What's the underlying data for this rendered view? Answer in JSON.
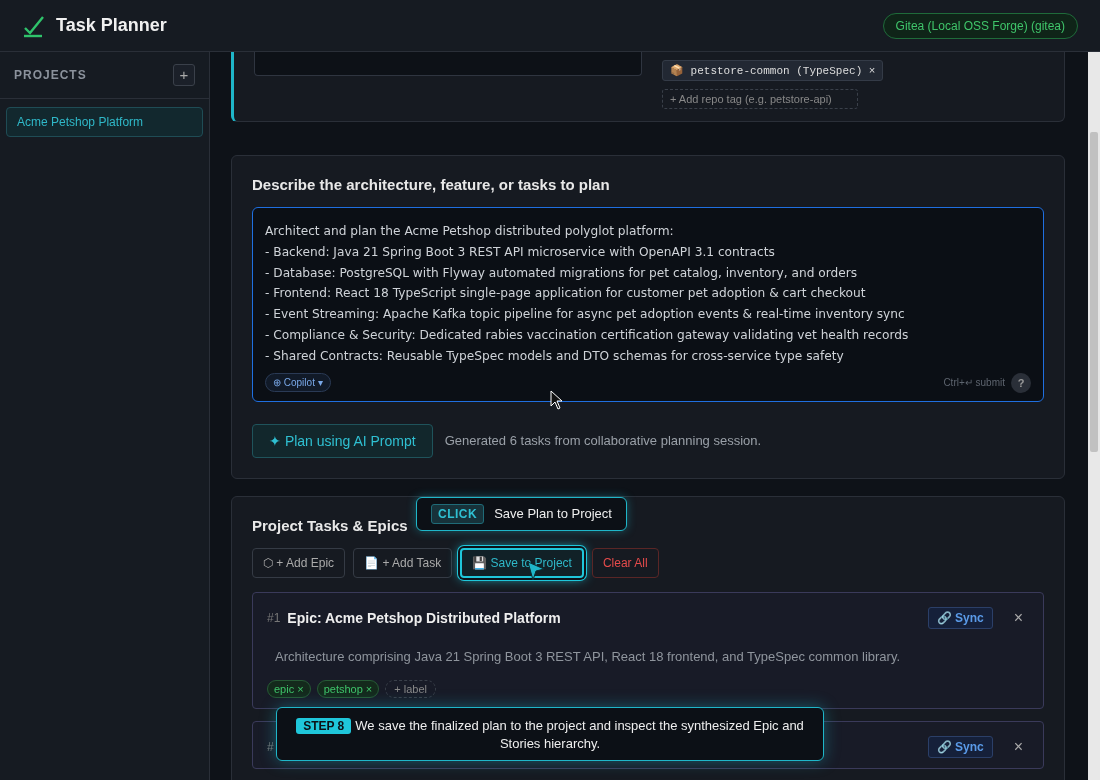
{
  "app": {
    "title": "Task Planner",
    "provider_badge": "Gitea (Local OSS Forge) (gitea)"
  },
  "sidebar": {
    "heading": "PROJECTS",
    "add_button": "+",
    "projects": [
      {
        "name": "Acme Petshop Platform",
        "selected": true
      }
    ]
  },
  "repo_section": {
    "repo_tags": [
      {
        "icon": "📦",
        "label": "petstore-common (TypeSpec)",
        "remove": "×"
      }
    ],
    "add_tag_placeholder": "+ Add repo tag (e.g. petstore-api)"
  },
  "prompt_section": {
    "heading": "Describe the architecture, feature, or tasks to plan",
    "prompt_lines": [
      "Architect and plan the Acme Petshop distributed polyglot platform:",
      "- Backend: Java 21 Spring Boot 3 REST API microservice with OpenAPI 3.1 contracts",
      "- Database: PostgreSQL with Flyway automated migrations for pet catalog, inventory, and orders",
      "- Frontend: React 18 TypeScript single-page application for customer pet adoption & cart checkout",
      "- Event Streaming: Apache Kafka topic pipeline for async pet adoption events & real-time inventory sync",
      "- Compliance & Security: Dedicated rabies vaccination certification gateway validating vet health records",
      "- Shared Contracts: Reusable TypeSpec models and DTO schemas for cross-service type safety"
    ],
    "model_selector": "⊕ Copilot ▾",
    "submit_hint": "Ctrl+↵ submit",
    "help_button": "?",
    "plan_button": "✦ Plan using AI Prompt",
    "status": "Generated 6 tasks from collaborative planning session."
  },
  "tasks_section": {
    "heading": "Project Tasks & Epics",
    "actions": [
      {
        "label": "⬡ + Add Epic",
        "kind": "plain"
      },
      {
        "label": "📄 + Add Task",
        "kind": "plain"
      },
      {
        "label": "💾 Save to Project",
        "kind": "highlighted"
      },
      {
        "label": "Clear All",
        "kind": "danger"
      }
    ],
    "tasks": [
      {
        "number": "#1",
        "title": "Epic: Acme Petshop Distributed Platform",
        "description": "Architecture comprising Java 21 Spring Boot 3 REST API, React 18 frontend, and TypeSpec common library.",
        "labels": [
          "epic ×",
          "petshop ×"
        ],
        "add_label": "+ label",
        "sync": "🔗 Sync",
        "close": "×"
      },
      {
        "number": "#",
        "sync": "🔗 Sync",
        "close": "×"
      }
    ]
  },
  "click_tooltip": {
    "badge": "CLICK",
    "text": "Save Plan to Project"
  },
  "step_tooltip": {
    "badge": "STEP 8",
    "text": "We save the finalized plan to the project and inspect the synthesized Epic and Stories hierarchy."
  }
}
